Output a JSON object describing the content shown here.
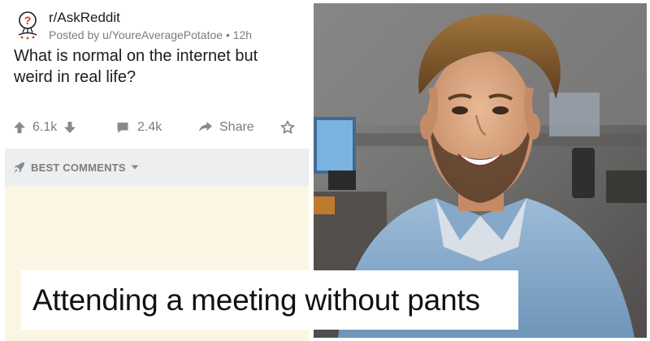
{
  "post": {
    "subreddit": "r/AskReddit",
    "posted_by": "Posted by u/YoureAveragePotatoe • 12h",
    "title": "What is normal on the internet but weird in real life?",
    "upvotes": "6.1k",
    "comments": "2.4k",
    "share_label": "Share"
  },
  "comments_sort": {
    "label": "BEST COMMENTS"
  },
  "caption": {
    "text": "Attending a meeting without pants"
  },
  "colors": {
    "meta_gray": "#7c7c7c",
    "text_dark": "#1c1c1c",
    "sort_bar_bg": "#edeef0",
    "comment_area_bg": "#fbf6e3"
  },
  "icons": {
    "avatar": "askreddit-question-mark-icon",
    "upvote": "upvote-arrow-icon",
    "downvote": "downvote-arrow-icon",
    "comments": "comment-bubble-icon",
    "share": "share-arrow-icon",
    "award": "award-icon",
    "sort": "rocket-icon",
    "caret": "chevron-down-icon"
  }
}
